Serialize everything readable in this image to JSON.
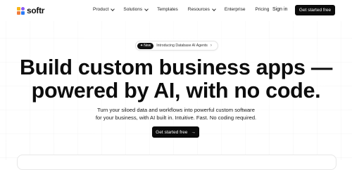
{
  "brand": {
    "name": "softr"
  },
  "nav": {
    "items": [
      {
        "label": "Product",
        "has_dropdown": true
      },
      {
        "label": "Solutions",
        "has_dropdown": true
      },
      {
        "label": "Templates",
        "has_dropdown": false
      },
      {
        "label": "Resources",
        "has_dropdown": true
      },
      {
        "label": "Enterprise",
        "has_dropdown": false
      },
      {
        "label": "Pricing",
        "has_dropdown": false
      }
    ],
    "sign_in": "Sign in",
    "cta": "Get started free"
  },
  "announcement": {
    "badge": "New",
    "text": "Introducing Database AI Agents",
    "arrow": "›"
  },
  "hero": {
    "title_line1": "Build custom business apps —",
    "title_line2": "powered by AI, with no code.",
    "subtitle_line1": "Turn your siloed data and workflows into powerful custom software",
    "subtitle_line2": "for your business, with AI built in. Intuitive. Fast. No coding required.",
    "cta": "Get started free",
    "cta_arrow": "→"
  },
  "colors": {
    "accent": "#0b0b0b",
    "logo_yellow": "#f7b61b",
    "logo_purple": "#8b5cf6",
    "logo_orange": "#f27d3b",
    "logo_blue": "#2e7cf6"
  }
}
